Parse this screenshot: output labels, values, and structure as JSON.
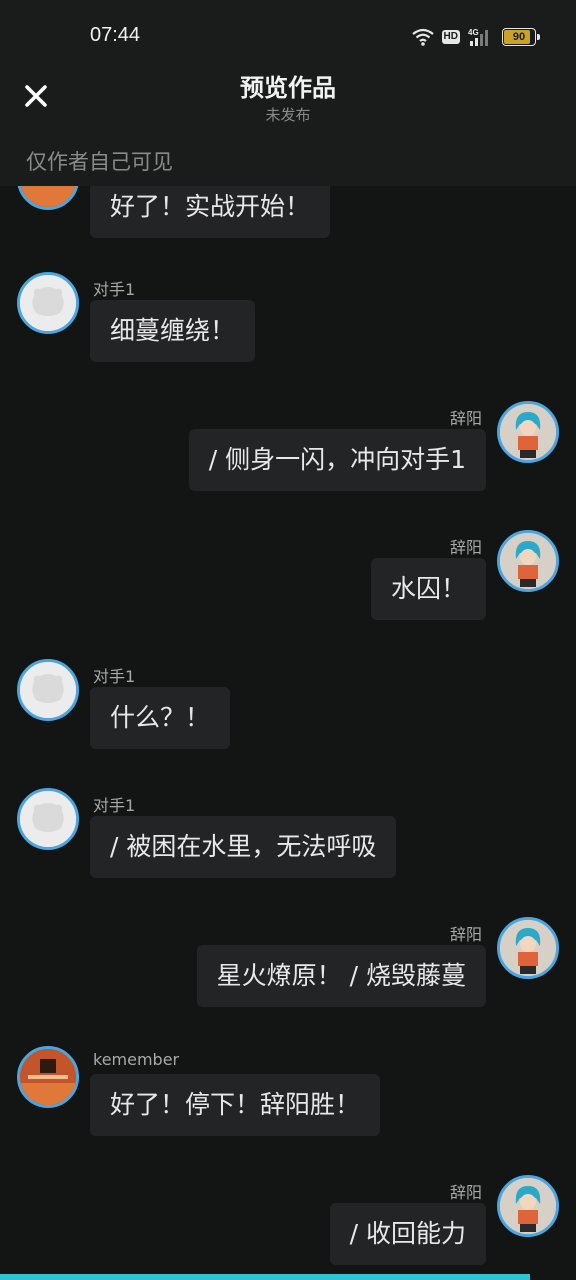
{
  "status": {
    "time": "07:44",
    "hd": "HD",
    "network": "4G",
    "battery": "90",
    "battery_level": 0.9
  },
  "header": {
    "title": "预览作品",
    "subtitle": "未发布",
    "close_icon": "close-icon"
  },
  "notice": "仅作者自己可见",
  "messages": [
    {
      "side": "left",
      "name": "",
      "text": "好了！实战开始！",
      "avatar": "kemember"
    },
    {
      "side": "left",
      "name": "对手1",
      "text": "细蔓缠绕！",
      "avatar": "ghost"
    },
    {
      "side": "right",
      "name": "辞阳",
      "text": "/ 侧身一闪，冲向对手1",
      "avatar": "anime"
    },
    {
      "side": "right",
      "name": "辞阳",
      "text": "水囚！",
      "avatar": "anime"
    },
    {
      "side": "left",
      "name": "对手1",
      "text": "什么？！",
      "avatar": "ghost"
    },
    {
      "side": "left",
      "name": "对手1",
      "text": "/ 被困在水里，无法呼吸",
      "avatar": "ghost"
    },
    {
      "side": "right",
      "name": "辞阳",
      "text": "星火燎原！ / 烧毁藤蔓",
      "avatar": "anime"
    },
    {
      "side": "left",
      "name": "kemember",
      "text": "好了！停下！辞阳胜！",
      "avatar": "kemember"
    },
    {
      "side": "right",
      "name": "辞阳",
      "text": "/ 收回能力",
      "avatar": "anime"
    }
  ],
  "colors": {
    "background": "#131414",
    "bubble": "#232425",
    "avatar_ring": "#4aa6e0",
    "progress": "#2ec4d6"
  }
}
